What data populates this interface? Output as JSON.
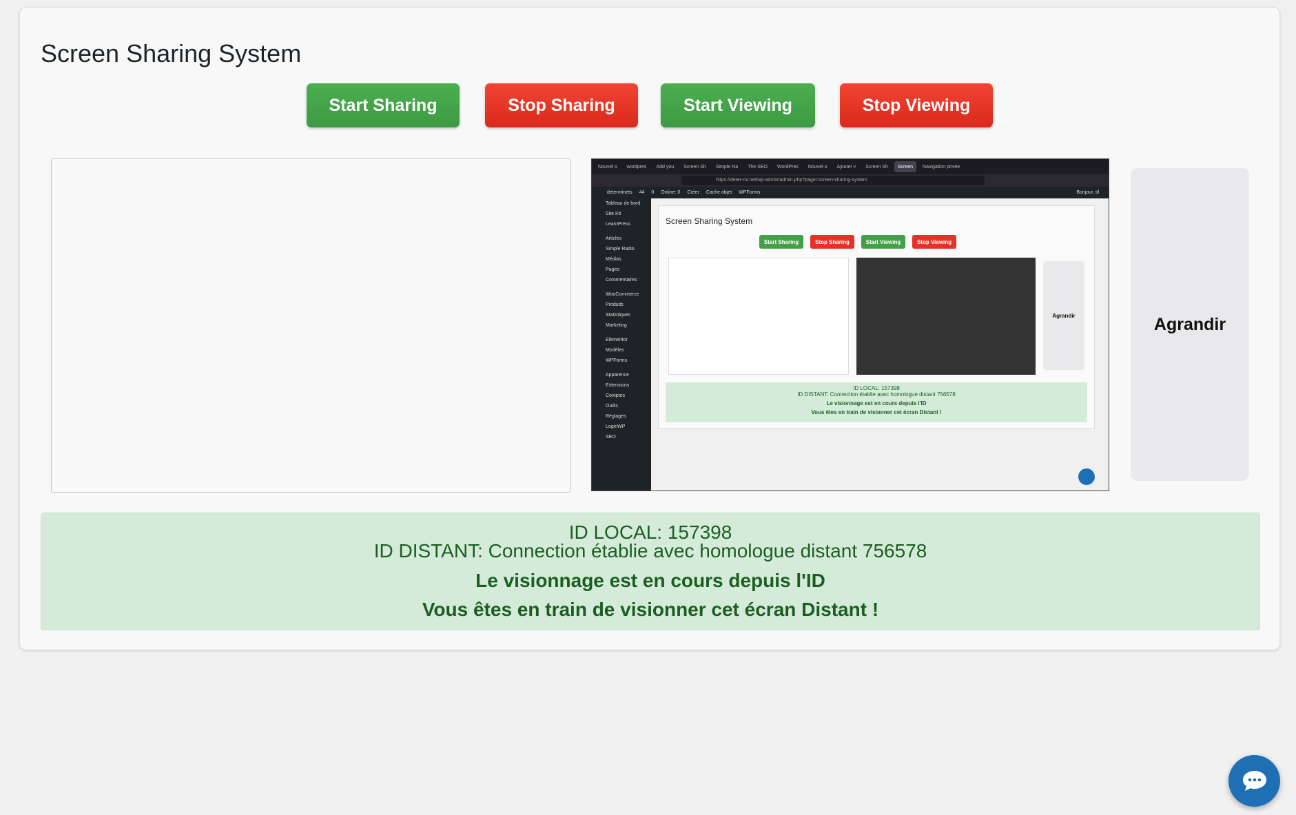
{
  "page": {
    "title": "Screen Sharing System"
  },
  "buttons": {
    "start_sharing": "Start Sharing",
    "stop_sharing": "Stop Sharing",
    "start_viewing": "Start Viewing",
    "stop_viewing": "Stop Viewing",
    "agrandir": "Agrandir"
  },
  "status": {
    "id_local": "ID LOCAL: 157398",
    "id_distant": "ID DISTANT: Connection établie avec homologue distant 756578",
    "viewing_line": "Le visionnage est en cours depuis l'ID",
    "viewing_remote": "Vous êtes en train de visionner cet écran Distant !"
  },
  "remote_screen": {
    "tabs": [
      "Nouvel o",
      "wordpres",
      "Add you",
      "Screen Sh",
      "Simple Ra",
      "The SEO",
      "WordPres",
      "Nouvel o",
      "Ajouter v",
      "Screen Sh",
      "Screen",
      "Navigation privée"
    ],
    "url": "https://deter-mi.net/wp-admin/admin.php?page=screen-sharing-system",
    "adminbar": [
      "determinets",
      "44",
      "0",
      "Online: 0",
      "Créer",
      "Cache objet",
      "WPForms",
      "Bonjour, til"
    ],
    "menu": [
      "Tableau de bord",
      "Site Kit",
      "LearnPress",
      "Articles",
      "Simple Radio",
      "Médias",
      "Pages",
      "Commentaires",
      "WooCommerce",
      "Produits",
      "Statistiques",
      "Marketing",
      "Elementor",
      "Modèles",
      "WPForms",
      "Apparence",
      "Extensions",
      "Comptes",
      "Outils",
      "Réglages",
      "LoginWP",
      "SEO"
    ],
    "title": "Screen Sharing System",
    "buttons": [
      "Start Sharing",
      "Stop Sharing",
      "Start Viewing",
      "Stop Viewing"
    ],
    "agrandir": "Agrandir",
    "status": [
      "ID LOCAL: 157398",
      "ID DISTANT: Connection établie avec homologue distant 756578",
      "Le visionnage est en cours depuis l'ID",
      "Vous êtes en train de visionner cet écran Distant !"
    ]
  },
  "colors": {
    "green": "#43a047",
    "red": "#e53126",
    "status_bg": "#d4ebd9",
    "status_text": "#1b5e20",
    "chat_fab": "#1f6fb5"
  },
  "icons": {
    "chat": "chat-bubble-icon"
  }
}
